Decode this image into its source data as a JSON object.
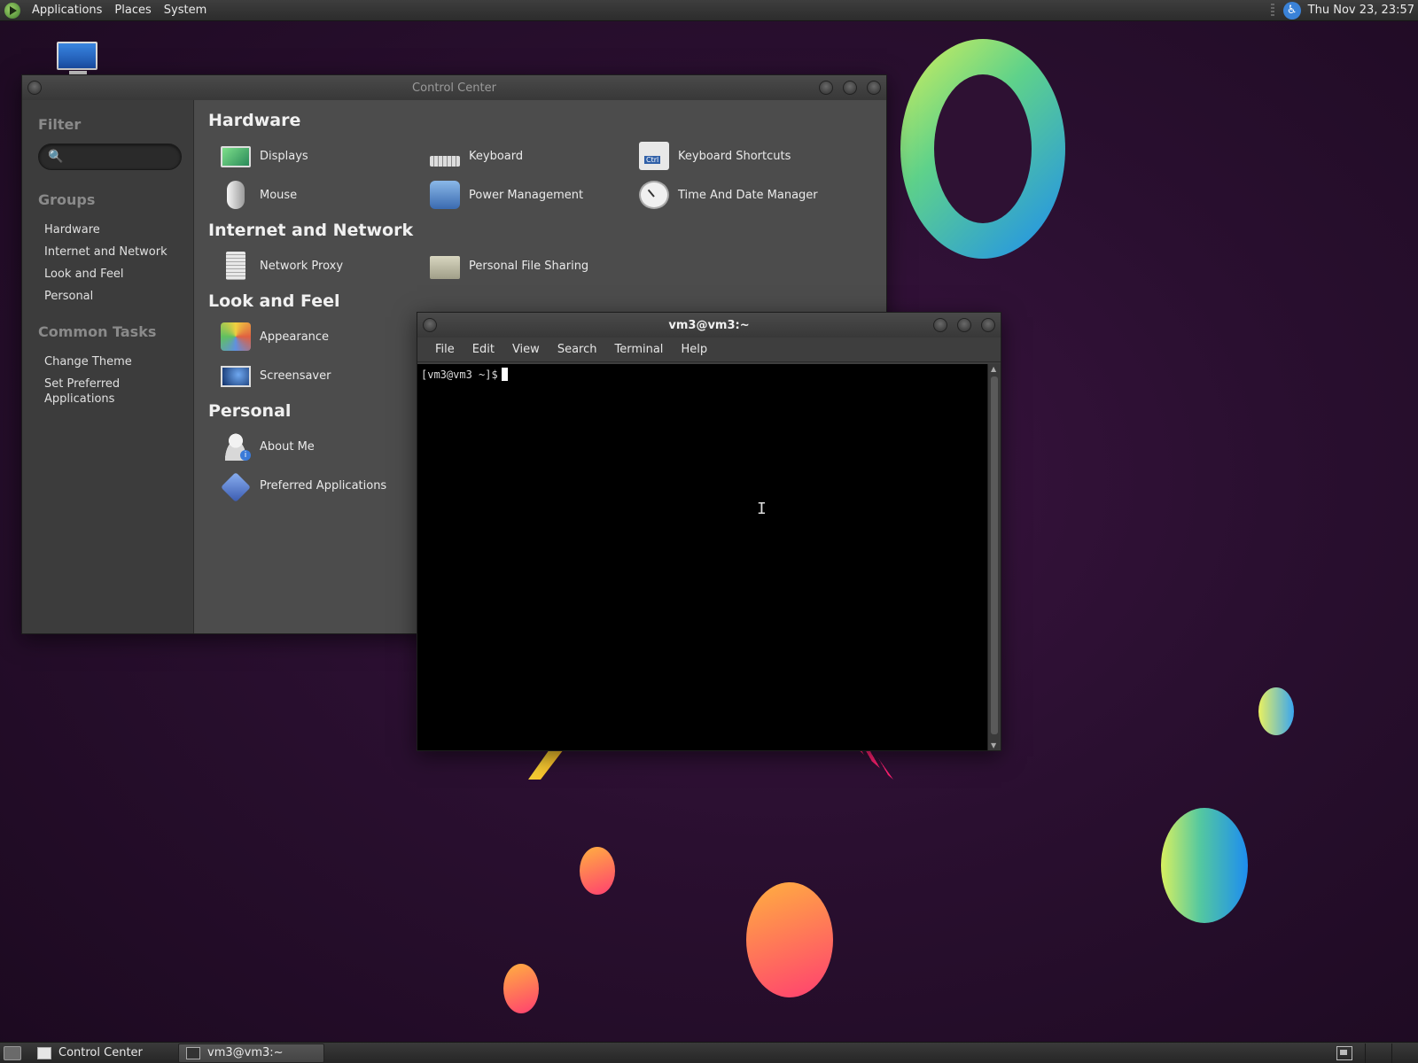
{
  "top_panel": {
    "menus": [
      "Applications",
      "Places",
      "System"
    ],
    "clock": "Thu Nov 23, 23:57"
  },
  "control_center": {
    "title": "Control Center",
    "sidebar": {
      "filter_heading": "Filter",
      "search_placeholder": "",
      "groups_heading": "Groups",
      "groups": [
        "Hardware",
        "Internet and Network",
        "Look and Feel",
        "Personal"
      ],
      "tasks_heading": "Common Tasks",
      "tasks": [
        "Change Theme",
        "Set Preferred Applications"
      ]
    },
    "sections": [
      {
        "title": "Hardware",
        "items": [
          {
            "label": "Displays",
            "icon": "display-icon"
          },
          {
            "label": "Keyboard",
            "icon": "keyboard-icon"
          },
          {
            "label": "Keyboard Shortcuts",
            "icon": "keyboard-shortcuts-icon"
          },
          {
            "label": "Mouse",
            "icon": "mouse-icon"
          },
          {
            "label": "Power Management",
            "icon": "power-icon"
          },
          {
            "label": "Time And Date Manager",
            "icon": "clock-icon"
          }
        ]
      },
      {
        "title": "Internet and Network",
        "items": [
          {
            "label": "Network Proxy",
            "icon": "proxy-icon"
          },
          {
            "label": "Personal File Sharing",
            "icon": "file-sharing-icon"
          }
        ]
      },
      {
        "title": "Look and Feel",
        "items": [
          {
            "label": "Appearance",
            "icon": "appearance-icon"
          },
          {
            "label": "Screensaver",
            "icon": "screensaver-icon"
          }
        ]
      },
      {
        "title": "Personal",
        "items": [
          {
            "label": "About Me",
            "icon": "about-me-icon"
          },
          {
            "label": "Preferred Applications",
            "icon": "preferred-apps-icon"
          }
        ]
      }
    ]
  },
  "terminal": {
    "title": "vm3@vm3:~",
    "menu": [
      "File",
      "Edit",
      "View",
      "Search",
      "Terminal",
      "Help"
    ],
    "prompt": "[vm3@vm3 ~]$"
  },
  "taskbar": {
    "tasks": [
      {
        "label": "Control Center",
        "active": false
      },
      {
        "label": "vm3@vm3:~",
        "active": true
      }
    ]
  }
}
